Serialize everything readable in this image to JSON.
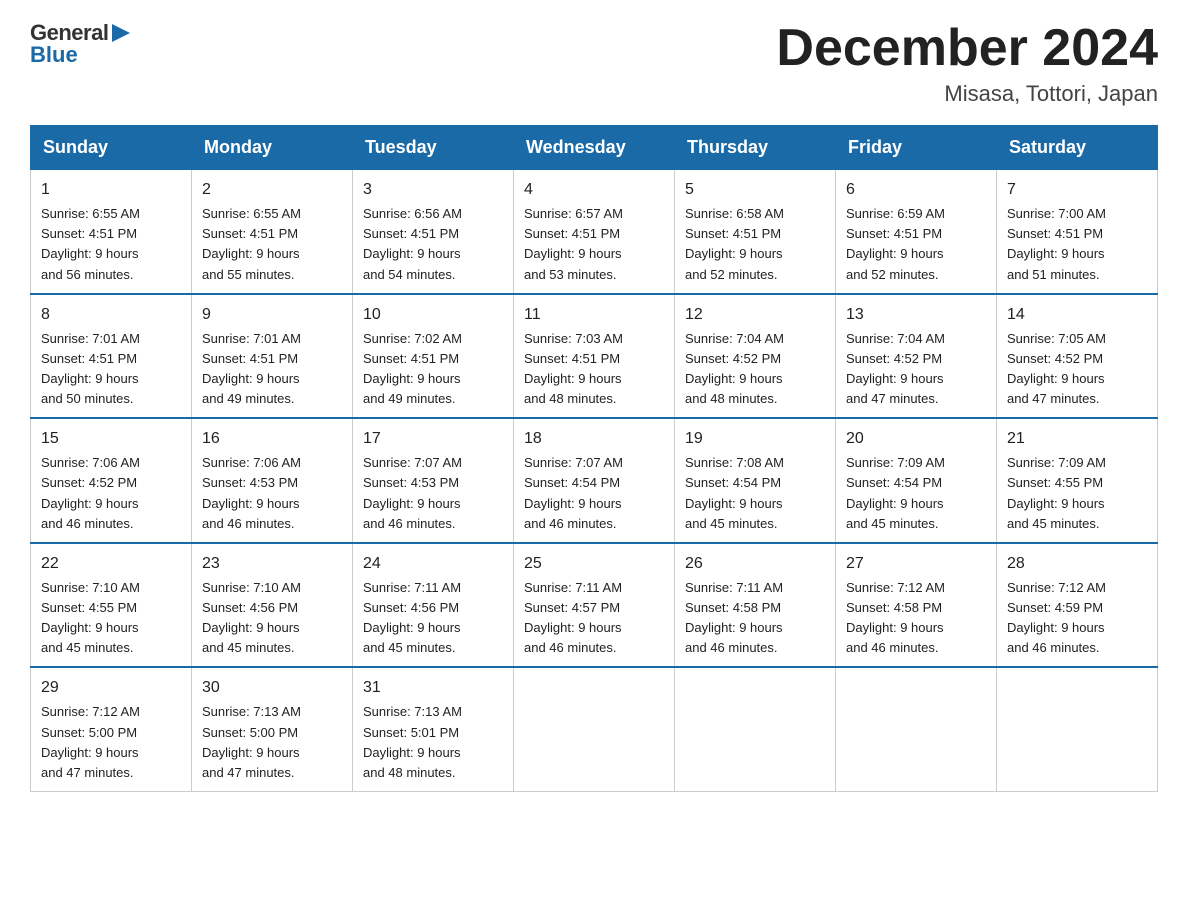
{
  "logo": {
    "general": "General",
    "blue": "Blue"
  },
  "title": "December 2024",
  "location": "Misasa, Tottori, Japan",
  "days_of_week": [
    "Sunday",
    "Monday",
    "Tuesday",
    "Wednesday",
    "Thursday",
    "Friday",
    "Saturday"
  ],
  "weeks": [
    [
      {
        "day": "1",
        "sunrise": "Sunrise: 6:55 AM",
        "sunset": "Sunset: 4:51 PM",
        "daylight": "Daylight: 9 hours",
        "minutes": "and 56 minutes."
      },
      {
        "day": "2",
        "sunrise": "Sunrise: 6:55 AM",
        "sunset": "Sunset: 4:51 PM",
        "daylight": "Daylight: 9 hours",
        "minutes": "and 55 minutes."
      },
      {
        "day": "3",
        "sunrise": "Sunrise: 6:56 AM",
        "sunset": "Sunset: 4:51 PM",
        "daylight": "Daylight: 9 hours",
        "minutes": "and 54 minutes."
      },
      {
        "day": "4",
        "sunrise": "Sunrise: 6:57 AM",
        "sunset": "Sunset: 4:51 PM",
        "daylight": "Daylight: 9 hours",
        "minutes": "and 53 minutes."
      },
      {
        "day": "5",
        "sunrise": "Sunrise: 6:58 AM",
        "sunset": "Sunset: 4:51 PM",
        "daylight": "Daylight: 9 hours",
        "minutes": "and 52 minutes."
      },
      {
        "day": "6",
        "sunrise": "Sunrise: 6:59 AM",
        "sunset": "Sunset: 4:51 PM",
        "daylight": "Daylight: 9 hours",
        "minutes": "and 52 minutes."
      },
      {
        "day": "7",
        "sunrise": "Sunrise: 7:00 AM",
        "sunset": "Sunset: 4:51 PM",
        "daylight": "Daylight: 9 hours",
        "minutes": "and 51 minutes."
      }
    ],
    [
      {
        "day": "8",
        "sunrise": "Sunrise: 7:01 AM",
        "sunset": "Sunset: 4:51 PM",
        "daylight": "Daylight: 9 hours",
        "minutes": "and 50 minutes."
      },
      {
        "day": "9",
        "sunrise": "Sunrise: 7:01 AM",
        "sunset": "Sunset: 4:51 PM",
        "daylight": "Daylight: 9 hours",
        "minutes": "and 49 minutes."
      },
      {
        "day": "10",
        "sunrise": "Sunrise: 7:02 AM",
        "sunset": "Sunset: 4:51 PM",
        "daylight": "Daylight: 9 hours",
        "minutes": "and 49 minutes."
      },
      {
        "day": "11",
        "sunrise": "Sunrise: 7:03 AM",
        "sunset": "Sunset: 4:51 PM",
        "daylight": "Daylight: 9 hours",
        "minutes": "and 48 minutes."
      },
      {
        "day": "12",
        "sunrise": "Sunrise: 7:04 AM",
        "sunset": "Sunset: 4:52 PM",
        "daylight": "Daylight: 9 hours",
        "minutes": "and 48 minutes."
      },
      {
        "day": "13",
        "sunrise": "Sunrise: 7:04 AM",
        "sunset": "Sunset: 4:52 PM",
        "daylight": "Daylight: 9 hours",
        "minutes": "and 47 minutes."
      },
      {
        "day": "14",
        "sunrise": "Sunrise: 7:05 AM",
        "sunset": "Sunset: 4:52 PM",
        "daylight": "Daylight: 9 hours",
        "minutes": "and 47 minutes."
      }
    ],
    [
      {
        "day": "15",
        "sunrise": "Sunrise: 7:06 AM",
        "sunset": "Sunset: 4:52 PM",
        "daylight": "Daylight: 9 hours",
        "minutes": "and 46 minutes."
      },
      {
        "day": "16",
        "sunrise": "Sunrise: 7:06 AM",
        "sunset": "Sunset: 4:53 PM",
        "daylight": "Daylight: 9 hours",
        "minutes": "and 46 minutes."
      },
      {
        "day": "17",
        "sunrise": "Sunrise: 7:07 AM",
        "sunset": "Sunset: 4:53 PM",
        "daylight": "Daylight: 9 hours",
        "minutes": "and 46 minutes."
      },
      {
        "day": "18",
        "sunrise": "Sunrise: 7:07 AM",
        "sunset": "Sunset: 4:54 PM",
        "daylight": "Daylight: 9 hours",
        "minutes": "and 46 minutes."
      },
      {
        "day": "19",
        "sunrise": "Sunrise: 7:08 AM",
        "sunset": "Sunset: 4:54 PM",
        "daylight": "Daylight: 9 hours",
        "minutes": "and 45 minutes."
      },
      {
        "day": "20",
        "sunrise": "Sunrise: 7:09 AM",
        "sunset": "Sunset: 4:54 PM",
        "daylight": "Daylight: 9 hours",
        "minutes": "and 45 minutes."
      },
      {
        "day": "21",
        "sunrise": "Sunrise: 7:09 AM",
        "sunset": "Sunset: 4:55 PM",
        "daylight": "Daylight: 9 hours",
        "minutes": "and 45 minutes."
      }
    ],
    [
      {
        "day": "22",
        "sunrise": "Sunrise: 7:10 AM",
        "sunset": "Sunset: 4:55 PM",
        "daylight": "Daylight: 9 hours",
        "minutes": "and 45 minutes."
      },
      {
        "day": "23",
        "sunrise": "Sunrise: 7:10 AM",
        "sunset": "Sunset: 4:56 PM",
        "daylight": "Daylight: 9 hours",
        "minutes": "and 45 minutes."
      },
      {
        "day": "24",
        "sunrise": "Sunrise: 7:11 AM",
        "sunset": "Sunset: 4:56 PM",
        "daylight": "Daylight: 9 hours",
        "minutes": "and 45 minutes."
      },
      {
        "day": "25",
        "sunrise": "Sunrise: 7:11 AM",
        "sunset": "Sunset: 4:57 PM",
        "daylight": "Daylight: 9 hours",
        "minutes": "and 46 minutes."
      },
      {
        "day": "26",
        "sunrise": "Sunrise: 7:11 AM",
        "sunset": "Sunset: 4:58 PM",
        "daylight": "Daylight: 9 hours",
        "minutes": "and 46 minutes."
      },
      {
        "day": "27",
        "sunrise": "Sunrise: 7:12 AM",
        "sunset": "Sunset: 4:58 PM",
        "daylight": "Daylight: 9 hours",
        "minutes": "and 46 minutes."
      },
      {
        "day": "28",
        "sunrise": "Sunrise: 7:12 AM",
        "sunset": "Sunset: 4:59 PM",
        "daylight": "Daylight: 9 hours",
        "minutes": "and 46 minutes."
      }
    ],
    [
      {
        "day": "29",
        "sunrise": "Sunrise: 7:12 AM",
        "sunset": "Sunset: 5:00 PM",
        "daylight": "Daylight: 9 hours",
        "minutes": "and 47 minutes."
      },
      {
        "day": "30",
        "sunrise": "Sunrise: 7:13 AM",
        "sunset": "Sunset: 5:00 PM",
        "daylight": "Daylight: 9 hours",
        "minutes": "and 47 minutes."
      },
      {
        "day": "31",
        "sunrise": "Sunrise: 7:13 AM",
        "sunset": "Sunset: 5:01 PM",
        "daylight": "Daylight: 9 hours",
        "minutes": "and 48 minutes."
      },
      null,
      null,
      null,
      null
    ]
  ]
}
